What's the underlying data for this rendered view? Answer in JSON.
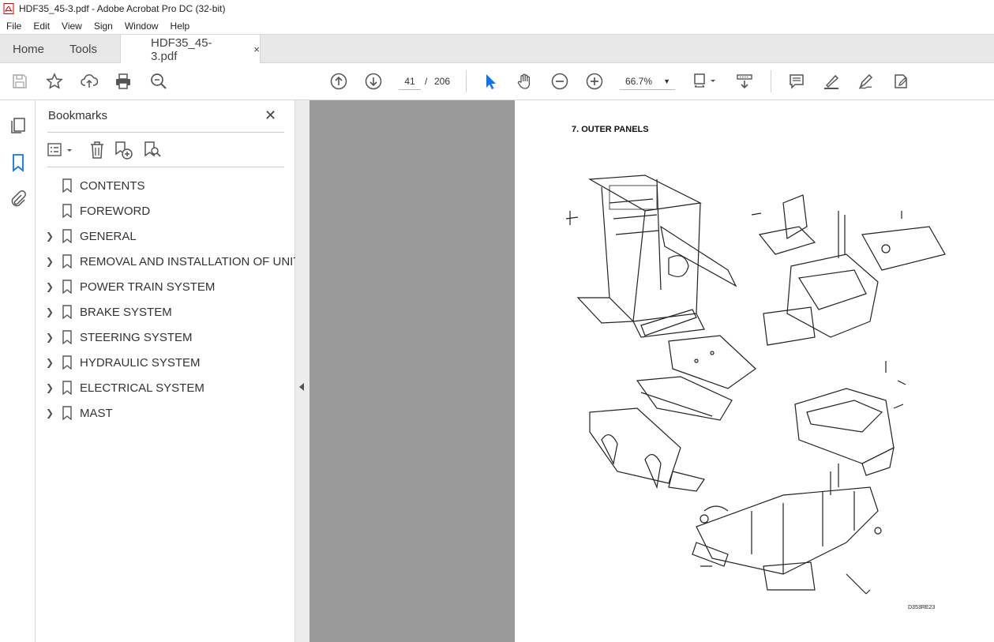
{
  "window": {
    "title": "HDF35_45-3.pdf - Adobe Acrobat Pro DC (32-bit)"
  },
  "menu": [
    "File",
    "Edit",
    "View",
    "Sign",
    "Window",
    "Help"
  ],
  "tabs": {
    "home": "Home",
    "tools": "Tools",
    "document": "HDF35_45-3.pdf",
    "close": "×"
  },
  "toolbar": {
    "current_page": "41",
    "page_separator": "/",
    "total_pages": "206",
    "zoom": "66.7%",
    "icons": [
      "save-icon",
      "star-icon",
      "upload-icon",
      "print-icon",
      "search-zoom-icon",
      "page-up-icon",
      "page-down-icon",
      "select-arrow-icon",
      "hand-icon",
      "zoom-out-icon",
      "zoom-in-icon",
      "fit-page-icon",
      "scroll-mode-icon",
      "comment-icon",
      "highlight-icon",
      "sign-icon",
      "edit-pdf-icon"
    ]
  },
  "bookmarks": {
    "title": "Bookmarks",
    "close": "✕",
    "items": [
      {
        "label": "CONTENTS",
        "expandable": false
      },
      {
        "label": "FOREWORD",
        "expandable": false
      },
      {
        "label": "GENERAL",
        "expandable": true
      },
      {
        "label": "REMOVAL AND INSTALLATION OF UNIT",
        "expandable": true
      },
      {
        "label": "POWER TRAIN SYSTEM",
        "expandable": true
      },
      {
        "label": "BRAKE SYSTEM",
        "expandable": true
      },
      {
        "label": "STEERING SYSTEM",
        "expandable": true
      },
      {
        "label": "HYDRAULIC SYSTEM",
        "expandable": true
      },
      {
        "label": "ELECTRICAL SYSTEM",
        "expandable": true
      },
      {
        "label": "MAST",
        "expandable": true
      }
    ]
  },
  "document": {
    "heading": "7. OUTER PANELS",
    "drawing_code": "D353RE23"
  }
}
